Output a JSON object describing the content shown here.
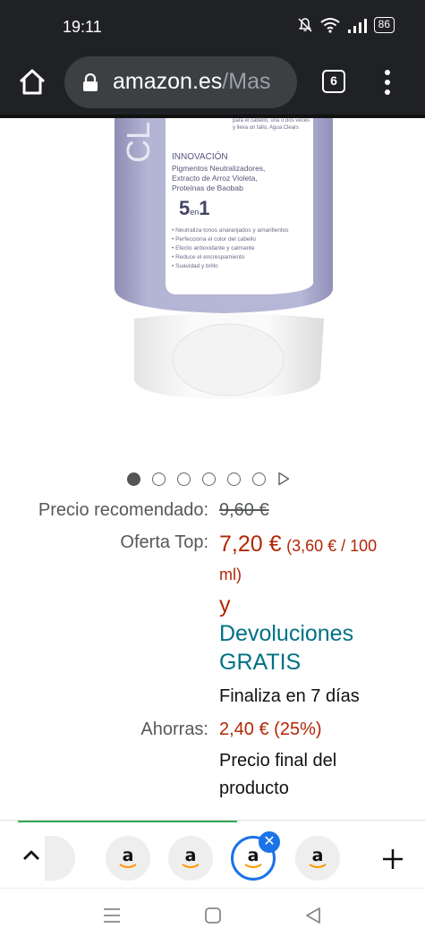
{
  "status_bar": {
    "time": "19:11",
    "battery": "86"
  },
  "browser": {
    "url_domain": "amazon.es",
    "url_path": "/Mas",
    "tab_count": "6"
  },
  "product_label": {
    "brand_partial": "CL",
    "tiny_top_line": "para el cabello, una o dos veces",
    "tiny_top_line2": "y lleva un tallo, Agua Clears",
    "section_title": "INNOVACIÓN",
    "ingredients": [
      "Pigmentos Neutralizadores,",
      "Extracto de Arroz Violeta,",
      "Proteínas de Baobab"
    ],
    "five_in_one_main": "5",
    "five_in_one_en": "en",
    "five_in_one_one": "1",
    "benefits": [
      "• Neutraliza tonos anaranjados y amarillentos",
      "• Perfecciona el color del cabello",
      "• Efecto antioxidante y calmante",
      "• Reduce el encrespamiento",
      "• Suavidad y brillo"
    ]
  },
  "carousel": {
    "total_dots": 6,
    "active_index": 0
  },
  "pricing": {
    "recommended_label": "Precio recomendado:",
    "recommended_value": "9,60 €",
    "offer_label": "Oferta Top:",
    "offer_price": "7,20 €",
    "offer_unit_a": "(3,60 € / 100",
    "offer_unit_b": "ml)",
    "y_text": "y",
    "returns_line1": "Devoluciones",
    "returns_line2": "GRATIS",
    "ends_text": "Finaliza en 7 días",
    "savings_label": "Ahorras:",
    "savings_value": "2,40 € (25%)",
    "final_line1": "Precio final del",
    "final_line2": "producto"
  },
  "tab_strip": {
    "tabs": [
      {
        "letter": ""
      },
      {
        "letter": "a"
      },
      {
        "letter": "a"
      },
      {
        "letter": "a"
      },
      {
        "letter": "a"
      }
    ],
    "selected_index": 3,
    "close_symbol": "✕"
  },
  "colors": {
    "price_red": "#b12704",
    "link_teal": "#007185",
    "chrome_dark": "#202124",
    "tab_blue": "#1a73e8"
  }
}
